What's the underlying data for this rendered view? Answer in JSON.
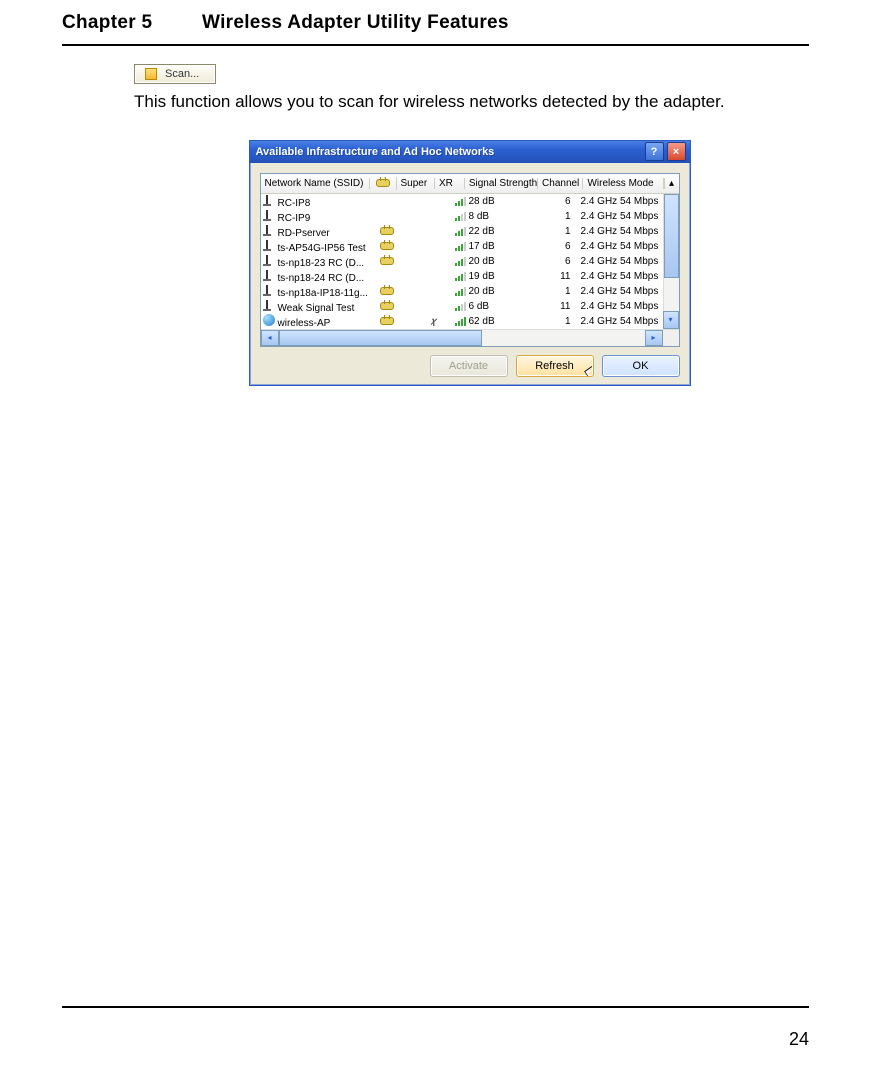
{
  "chapter": {
    "number": "Chapter 5",
    "title": "Wireless Adapter Utility Features"
  },
  "scan_button_label": "Scan...",
  "description": "This function allows you to scan for wireless networks detected by the adapter.",
  "dialog": {
    "title": "Available Infrastructure and Ad Hoc Networks",
    "help_glyph": "?",
    "close_glyph": "×",
    "columns": {
      "ssid": "Network Name (SSID)",
      "sec_icon_name": "lock-icon",
      "super": "Super",
      "xr": "XR",
      "signal": "Signal Strength",
      "channel": "Channel",
      "mode": "Wireless Mode"
    },
    "rows": [
      {
        "icon": "antenna",
        "ssid": "RC-IP8",
        "secure": false,
        "xr": false,
        "sig_level": "mid",
        "signal": "28 dB",
        "channel": "6",
        "mode": "2.4 GHz 54 Mbps"
      },
      {
        "icon": "antenna",
        "ssid": "RC-IP9",
        "secure": false,
        "xr": false,
        "sig_level": "low",
        "signal": "8 dB",
        "channel": "1",
        "mode": "2.4 GHz 54 Mbps"
      },
      {
        "icon": "antenna",
        "ssid": "RD-Pserver",
        "secure": true,
        "xr": false,
        "sig_level": "mid",
        "signal": "22 dB",
        "channel": "1",
        "mode": "2.4 GHz 54 Mbps"
      },
      {
        "icon": "antenna",
        "ssid": "ts-AP54G-IP56 Test",
        "secure": true,
        "xr": false,
        "sig_level": "mid",
        "signal": "17 dB",
        "channel": "6",
        "mode": "2.4 GHz 54 Mbps"
      },
      {
        "icon": "antenna",
        "ssid": "ts-np18-23 RC (D...",
        "secure": true,
        "xr": false,
        "sig_level": "mid",
        "signal": "20 dB",
        "channel": "6",
        "mode": "2.4 GHz 54 Mbps"
      },
      {
        "icon": "antenna",
        "ssid": "ts-np18-24 RC (D...",
        "secure": false,
        "xr": false,
        "sig_level": "mid",
        "signal": "19 dB",
        "channel": "11",
        "mode": "2.4 GHz 54 Mbps"
      },
      {
        "icon": "antenna",
        "ssid": "ts-np18a-IP18-11g...",
        "secure": true,
        "xr": false,
        "sig_level": "mid",
        "signal": "20 dB",
        "channel": "1",
        "mode": "2.4 GHz 54 Mbps"
      },
      {
        "icon": "antenna",
        "ssid": "Weak Signal Test",
        "secure": true,
        "xr": false,
        "sig_level": "low",
        "signal": "6 dB",
        "channel": "11",
        "mode": "2.4 GHz 54 Mbps"
      },
      {
        "icon": "globe",
        "ssid": "wireless-AP",
        "secure": true,
        "xr": true,
        "sig_level": "hi",
        "signal": "62 dB",
        "channel": "1",
        "mode": "2.4 GHz 54 Mbps"
      }
    ],
    "buttons": {
      "activate": "Activate",
      "refresh": "Refresh",
      "ok": "OK"
    }
  },
  "page_number": "24"
}
